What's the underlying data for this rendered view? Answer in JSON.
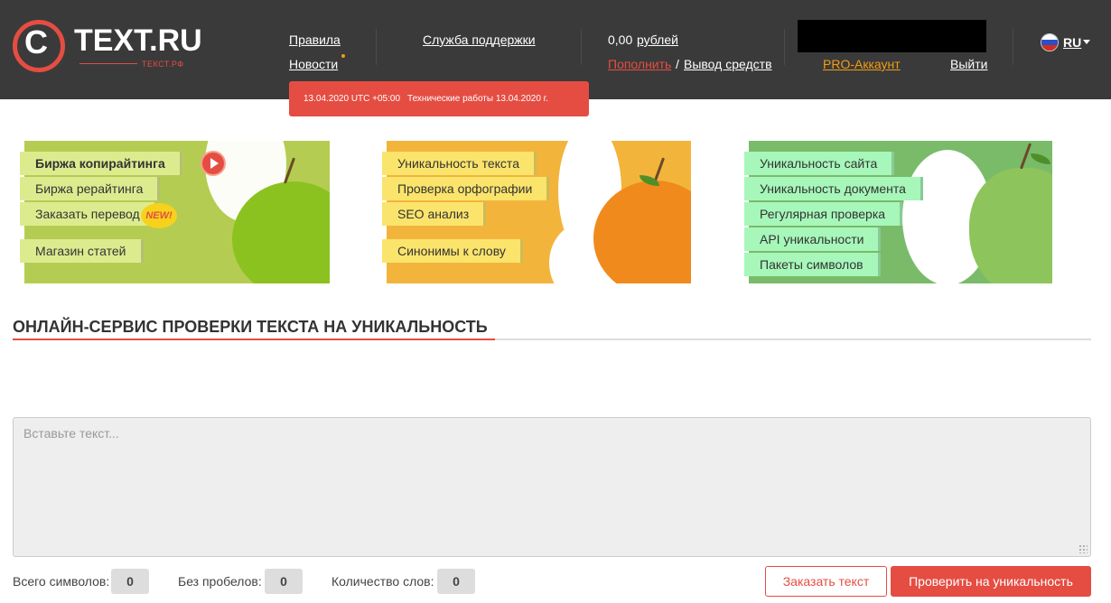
{
  "header": {
    "logo_name": "TEXT.RU",
    "logo_sub": "ТЕКСТ.РФ",
    "nav": {
      "rules": "Правила",
      "news": "Новости",
      "support": "Служба поддержки"
    },
    "balance": "0,00",
    "balance_link": "рублей",
    "topup": "Пополнить",
    "separator": "/",
    "withdraw": "Вывод средств",
    "pro": "PRO-Аккаунт",
    "logout": "Выйти",
    "lang": "RU"
  },
  "notice": {
    "date": "13.04.2020 UTC +05:00",
    "text": "Технические работы 13.04.2020 г."
  },
  "banners": {
    "left": {
      "items": [
        "Биржа копирайтинга",
        "Биржа рерайтинга",
        "Заказать перевод",
        "Магазин статей"
      ],
      "new_badge": "NEW!"
    },
    "middle": {
      "items": [
        "Уникальность текста",
        "Проверка орфографии",
        "SEO анализ",
        "Синонимы к слову"
      ]
    },
    "right": {
      "items": [
        "Уникальность сайта",
        "Уникальность документа",
        "Регулярная проверка",
        "API уникальности",
        "Пакеты символов"
      ]
    }
  },
  "main": {
    "title": "ОНЛАЙН-СЕРВИС ПРОВЕРКИ ТЕКСТА НА УНИКАЛЬНОСТЬ",
    "textarea_placeholder": "Вставьте текст...",
    "textarea_value": ""
  },
  "stats": {
    "total_label": "Всего символов:",
    "total_value": "0",
    "nospace_label": "Без пробелов:",
    "nospace_value": "0",
    "words_label": "Количество слов:",
    "words_value": "0"
  },
  "actions": {
    "order": "Заказать текст",
    "check": "Проверить на уникальность"
  },
  "colors": {
    "header_bg": "#3a3a3a",
    "accent": "#e54d42",
    "pro": "#f39c12"
  }
}
